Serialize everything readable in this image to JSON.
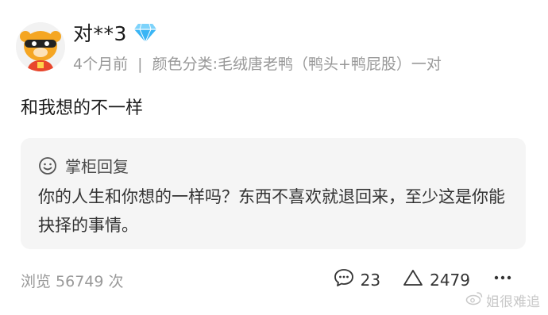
{
  "comment": {
    "username": "对**3",
    "meta": {
      "time": "4个月前",
      "separator": "|",
      "variant": "颜色分类:毛绒唐老鸭（鸭头+鸭屁股）一对"
    },
    "text": "和我想的不一样"
  },
  "reply": {
    "label": "掌柜回复",
    "text": "你的人生和你想的一样吗？东西不喜欢就退回来，至少这是你能抉择的事情。"
  },
  "footer": {
    "views": "浏览 56749 次",
    "comment_count": "23",
    "like_count": "2479"
  },
  "watermark": {
    "text": "姐很难追"
  },
  "icons": {
    "badge": "diamond-icon",
    "reply": "smile-icon",
    "comment": "comment-icon",
    "like": "triangle-like-icon",
    "more": "more-icon",
    "watermark": "weibo-icon"
  },
  "colors": {
    "diamond": "#3ab5f5",
    "avatar_orange": "#f5a623",
    "meta_gray": "#999999",
    "reply_bg": "#f5f5f5"
  }
}
